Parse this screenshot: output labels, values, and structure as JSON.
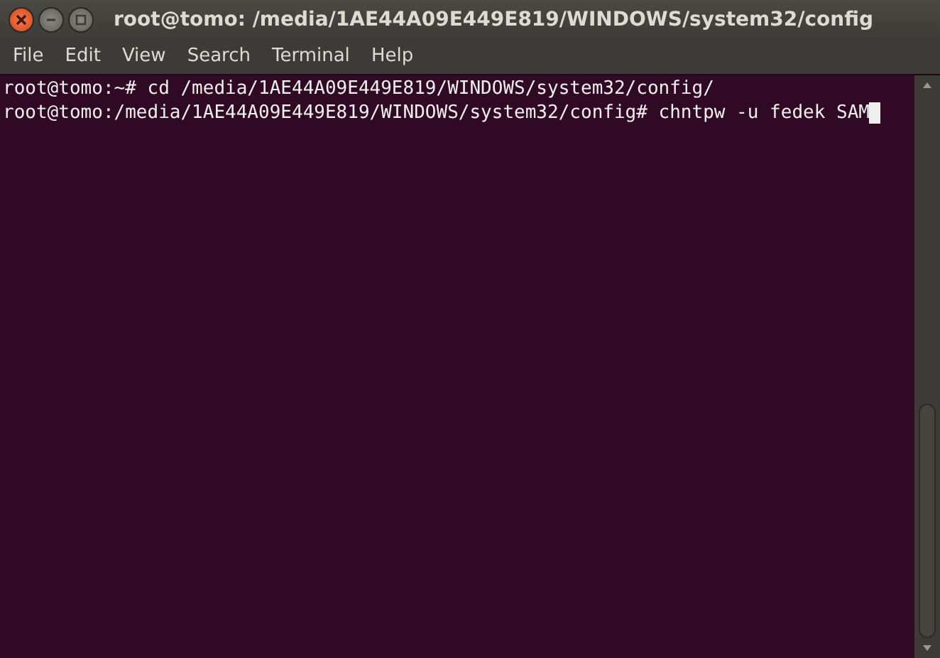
{
  "window": {
    "title": "root@tomo: /media/1AE44A09E449E819/WINDOWS/system32/config"
  },
  "menu": [
    "File",
    "Edit",
    "View",
    "Search",
    "Terminal",
    "Help"
  ],
  "terminal": {
    "lines": [
      "root@tomo:~# cd /media/1AE44A09E449E819/WINDOWS/system32/config/",
      "root@tomo:/media/1AE44A09E449E819/WINDOWS/system32/config# chntpw -u fedek SAM"
    ]
  }
}
